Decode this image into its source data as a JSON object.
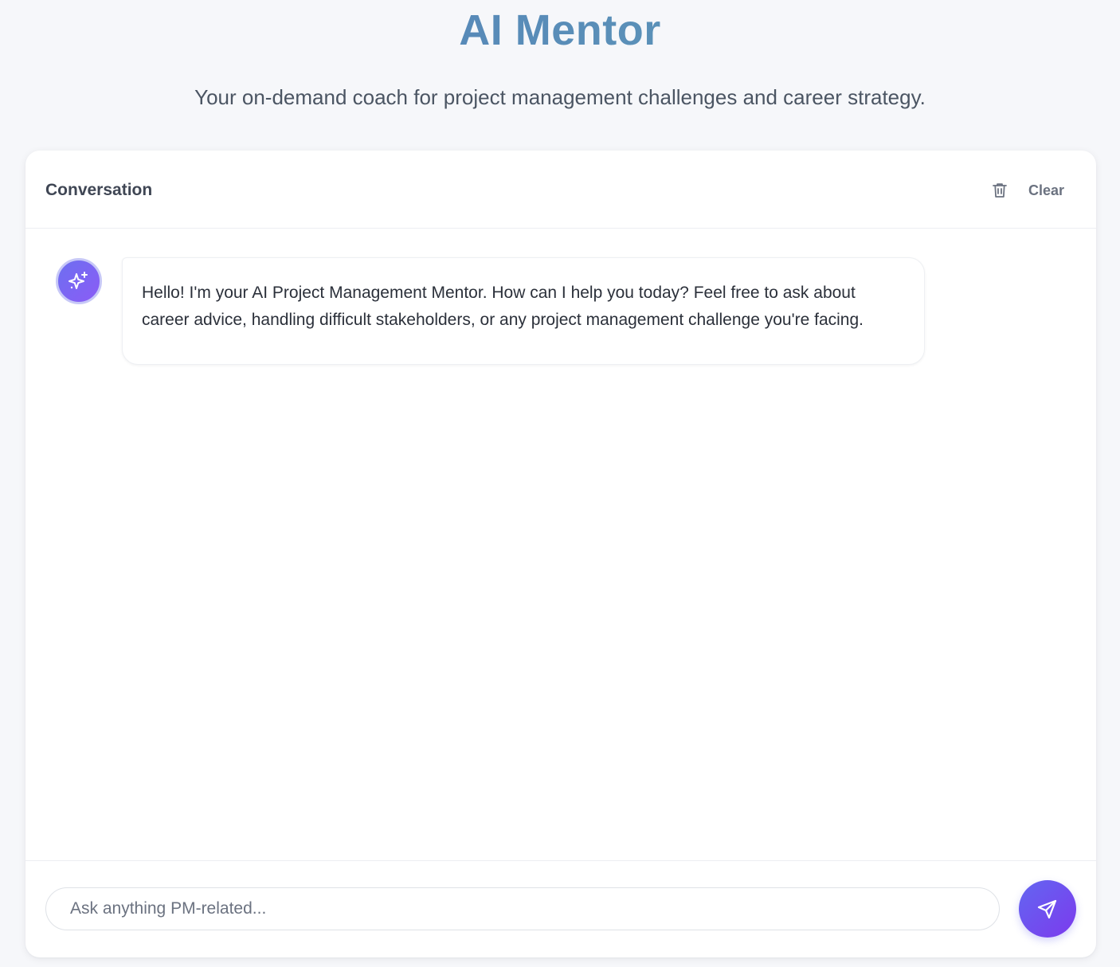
{
  "header": {
    "title": "AI Mentor",
    "subtitle": "Your on-demand coach for project management challenges and career strategy."
  },
  "conversation": {
    "title": "Conversation",
    "clear_label": "Clear",
    "clear_icon": "trash-icon",
    "messages": [
      {
        "role": "assistant",
        "avatar_icon": "sparkles-icon",
        "text": "Hello! I'm your AI Project Management Mentor. How can I help you today? Feel free to ask about career advice, handling difficult stakeholders, or any project management challenge you're facing."
      }
    ]
  },
  "composer": {
    "placeholder": "Ask anything PM-related...",
    "value": "",
    "send_icon": "send-icon"
  },
  "colors": {
    "title_gradient_start": "#4f79b8",
    "title_gradient_end": "#5a9cb0",
    "accent_start": "#6366f1",
    "accent_end": "#7c3aed"
  }
}
